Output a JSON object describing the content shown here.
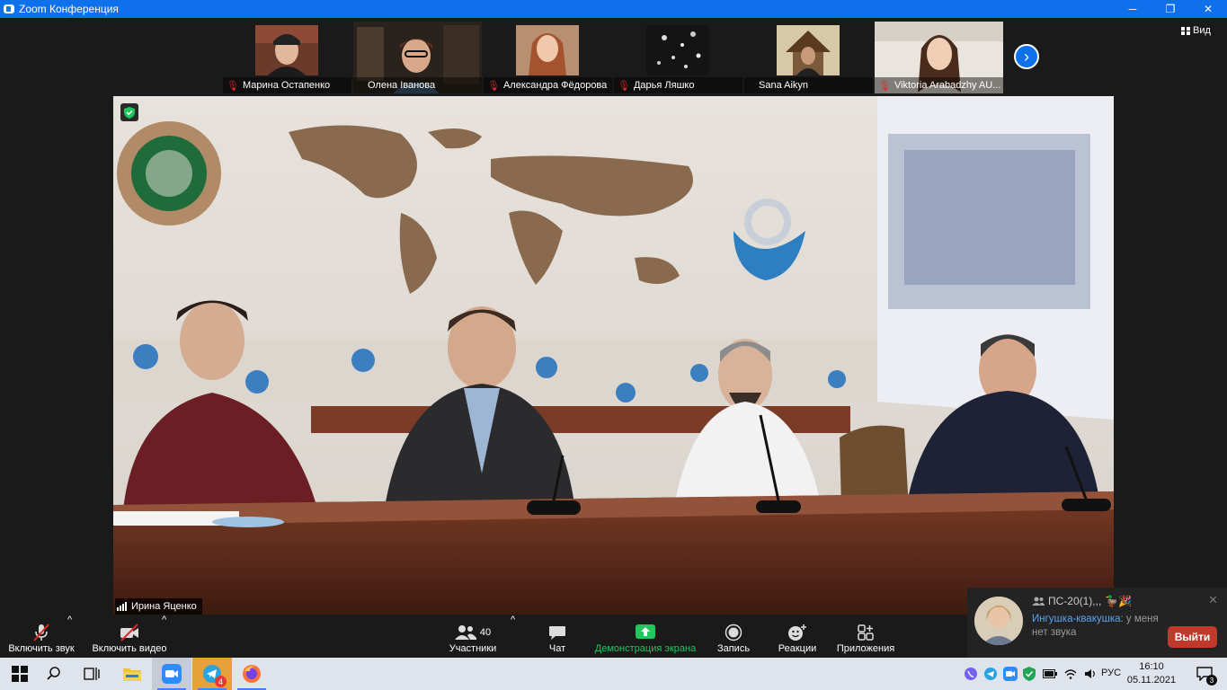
{
  "window": {
    "title": "Zoom Конференция",
    "controls": [
      "─",
      "❐",
      "✕"
    ]
  },
  "view": {
    "label": "Вид"
  },
  "participants_strip": [
    {
      "name": "Марина Остапенко",
      "muted": true
    },
    {
      "name": "Олена Іванова",
      "muted": false
    },
    {
      "name": "Александра Фёдорова",
      "muted": true
    },
    {
      "name": "Дарья Ляшко",
      "muted": true
    },
    {
      "name": "Sana Aikyn",
      "muted": false
    },
    {
      "name": "Viktoria Arabadzhy AU...",
      "muted": true
    }
  ],
  "next_arrow": "›",
  "main_speaker": {
    "name": "Ирина Яценко"
  },
  "toolbar": {
    "unmute": "Включить звук",
    "start_video": "Включить видео",
    "participants": "Участники",
    "participants_count": "40",
    "chat": "Чат",
    "share": "Демонстрация экрана",
    "record": "Запись",
    "reactions": "Реакции",
    "apps": "Приложения",
    "caret": "^"
  },
  "notification": {
    "group": "ПС-20(1),,,",
    "group_emoji": "🦆🎉",
    "from": "Ингушка-квакушка:",
    "text": "у меня нет звука",
    "close": "✕"
  },
  "leave_button": "Выйти",
  "taskbar": {
    "telegram_badge": "4",
    "lang": "РУС",
    "time": "16:10",
    "date": "05.11.2021",
    "notif_count": "3"
  },
  "colors": {
    "zoom_blue": "#0e71eb",
    "leave_red": "#c0392b",
    "share_green": "#22c55e"
  }
}
